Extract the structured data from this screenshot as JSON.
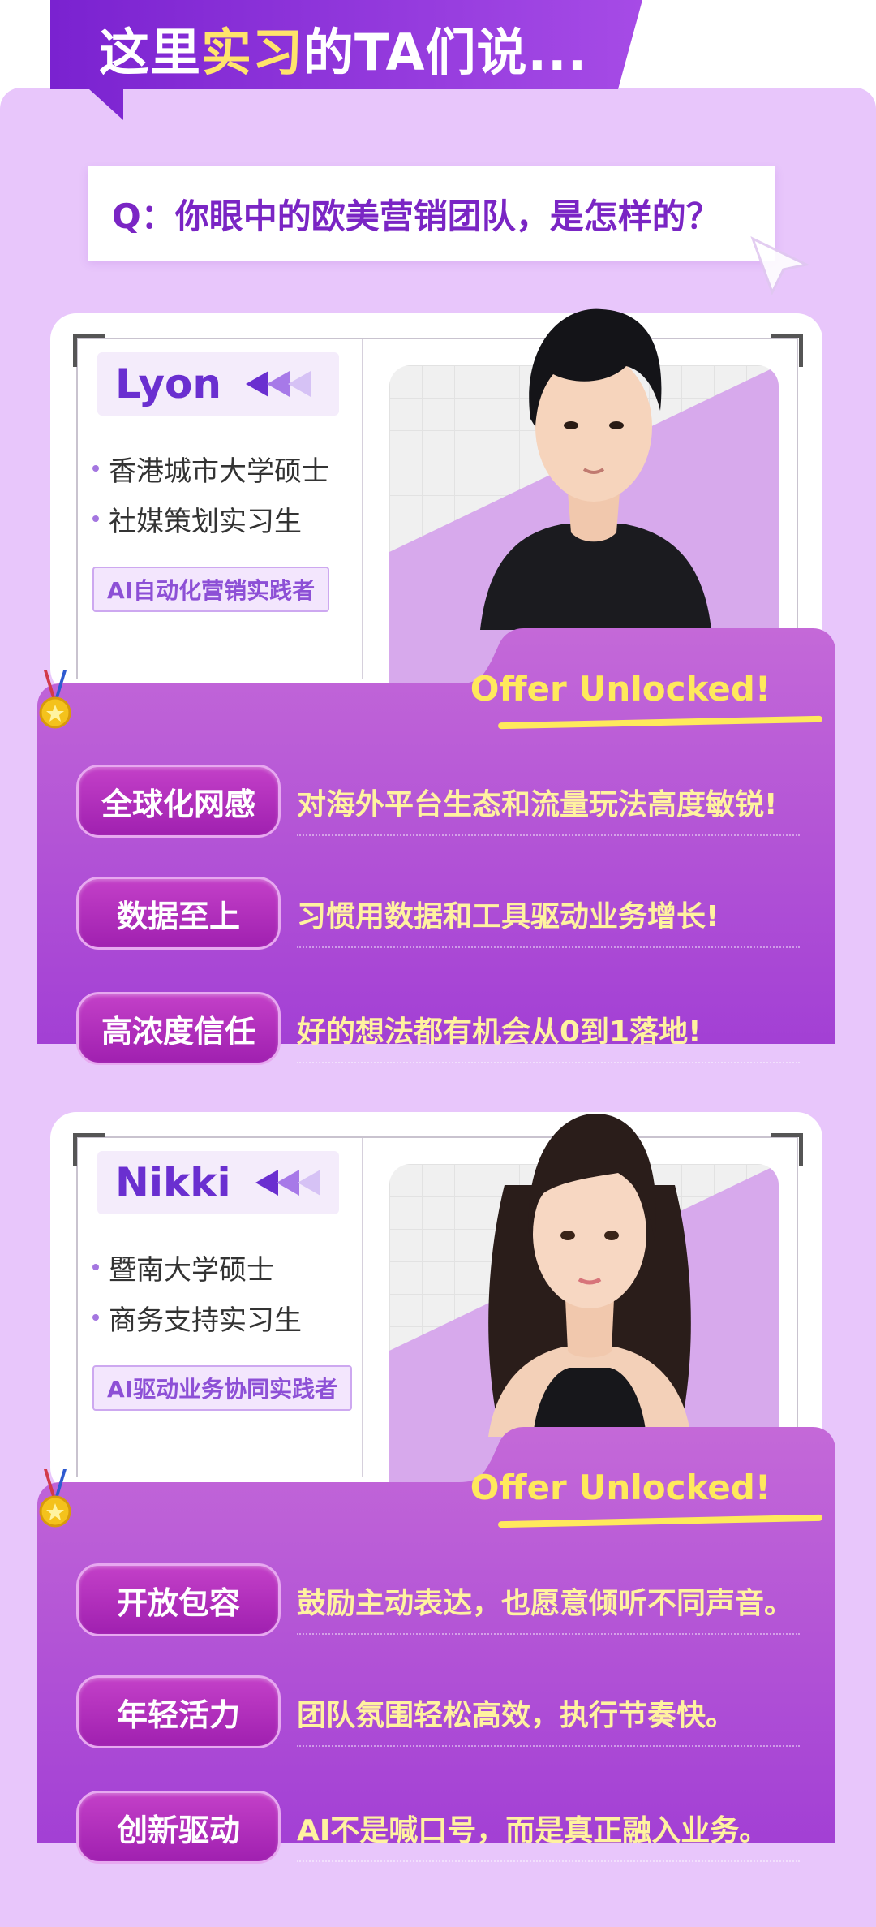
{
  "header": {
    "title_prefix": "这里",
    "title_highlight": "实习",
    "title_suffix": "的TA们说..."
  },
  "question": "Q：你眼中的欧美营销团队，是怎样的？",
  "colors": {
    "page_background": "#e8c6fb",
    "banner_purple": "#8a2ed6",
    "accent_yellow": "#ffe95c",
    "pill_magenta": "#b22dbc",
    "card_purple": "#a63fd6"
  },
  "profiles": [
    {
      "name": "Lyon",
      "bullets": [
        "香港城市大学硕士",
        "社媒策划实习生"
      ],
      "tag": "AI自动化营销实践者",
      "offer": "Offer Unlocked!",
      "traits": [
        {
          "label": "全球化网感",
          "desc": "对海外平台生态和流量玩法高度敏锐!"
        },
        {
          "label": "数据至上",
          "desc": "习惯用数据和工具驱动业务增长!"
        },
        {
          "label": "高浓度信任",
          "desc": "好的想法都有机会从0到1落地!"
        }
      ]
    },
    {
      "name": "Nikki",
      "bullets": [
        "暨南大学硕士",
        "商务支持实习生"
      ],
      "tag": "AI驱动业务协同实践者",
      "offer": "Offer Unlocked!",
      "traits": [
        {
          "label": "开放包容",
          "desc": "鼓励主动表达，也愿意倾听不同声音。"
        },
        {
          "label": "年轻活力",
          "desc": "团队氛围轻松高效，执行节奏快。"
        },
        {
          "label": "创新驱动",
          "desc": "AI不是喊口号，而是真正融入业务。"
        }
      ]
    }
  ]
}
